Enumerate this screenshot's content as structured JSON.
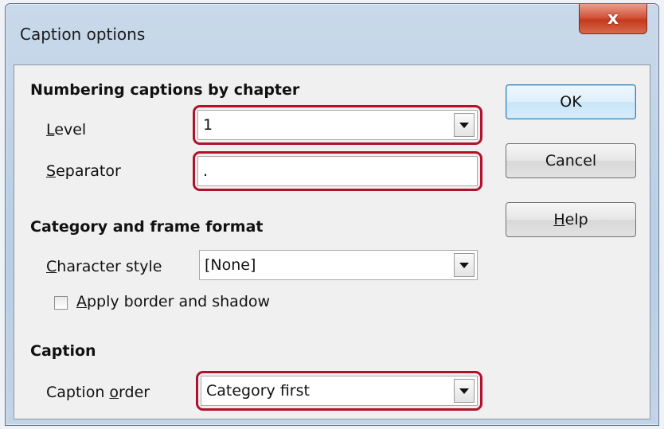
{
  "window": {
    "title": "Caption options",
    "close_label": "x"
  },
  "numbering": {
    "heading": "Numbering captions by chapter",
    "level_label_access": "L",
    "level_label_rest": "evel",
    "level_value": "1",
    "separator_label_access": "S",
    "separator_label_rest": "eparator",
    "separator_value": "."
  },
  "category": {
    "heading": "Category and frame format",
    "char_style_label_access": "C",
    "char_style_label_rest": "haracter style",
    "char_style_value": "[None]",
    "apply_border_access": "A",
    "apply_border_rest": "pply border and shadow",
    "apply_border_checked": false
  },
  "caption": {
    "heading": "Caption",
    "order_label_pre": "Caption ",
    "order_label_access": "o",
    "order_label_rest": "rder",
    "order_value": "Category first"
  },
  "buttons": {
    "ok": "OK",
    "cancel": "Cancel",
    "help_access": "H",
    "help_rest": "elp"
  },
  "colors": {
    "highlight": "#b3112b",
    "close_button": "#c43a1c",
    "default_button_border": "#3c7fb1"
  }
}
